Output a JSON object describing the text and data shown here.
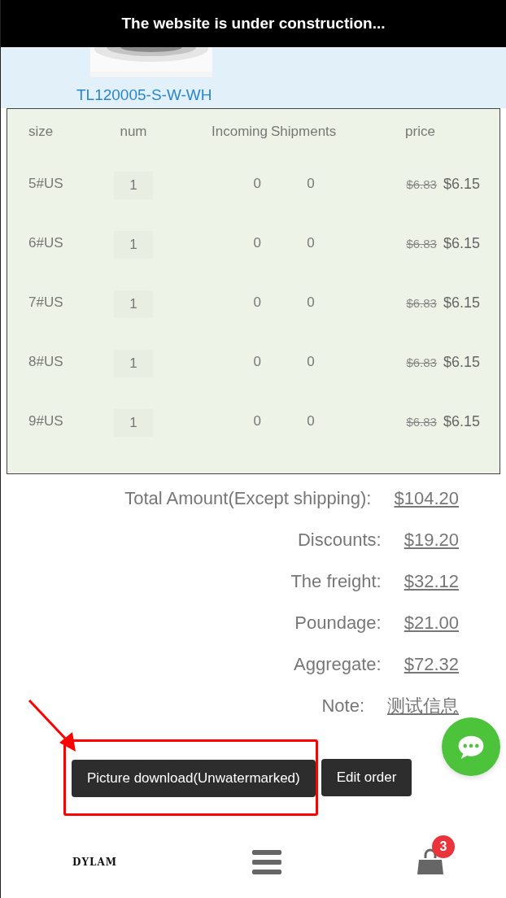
{
  "banner": {
    "text": "The website is under construction..."
  },
  "product": {
    "sku": "TL120005-S-W-WH"
  },
  "table": {
    "columns": [
      "size",
      "num",
      "Incoming",
      "Shipments",
      "price"
    ],
    "rows": [
      {
        "size": "5#US",
        "num": "1",
        "incoming": "0",
        "shipments": "0",
        "old_price": "$6.83",
        "price": "$6.15"
      },
      {
        "size": "6#US",
        "num": "1",
        "incoming": "0",
        "shipments": "0",
        "old_price": "$6.83",
        "price": "$6.15"
      },
      {
        "size": "7#US",
        "num": "1",
        "incoming": "0",
        "shipments": "0",
        "old_price": "$6.83",
        "price": "$6.15"
      },
      {
        "size": "8#US",
        "num": "1",
        "incoming": "0",
        "shipments": "0",
        "old_price": "$6.83",
        "price": "$6.15"
      },
      {
        "size": "9#US",
        "num": "1",
        "incoming": "0",
        "shipments": "0",
        "old_price": "$6.83",
        "price": "$6.15"
      }
    ]
  },
  "totals": [
    {
      "label": "Total Amount(Except shipping):",
      "value": "$104.20"
    },
    {
      "label": "Discounts:",
      "value": "$19.20"
    },
    {
      "label": "The freight:",
      "value": "$32.12"
    },
    {
      "label": "Poundage:",
      "value": "$21.00"
    },
    {
      "label": "Aggregate:",
      "value": "$72.32"
    },
    {
      "label": "Note:",
      "value": "测试信息"
    }
  ],
  "buttons": [
    {
      "label": "Picture download(Unwatermarked)",
      "highlighted": true
    },
    {
      "label": "Edit order",
      "highlighted": false
    }
  ],
  "bottom_nav": {
    "logo": "DYLAM",
    "cart_count": "3"
  }
}
